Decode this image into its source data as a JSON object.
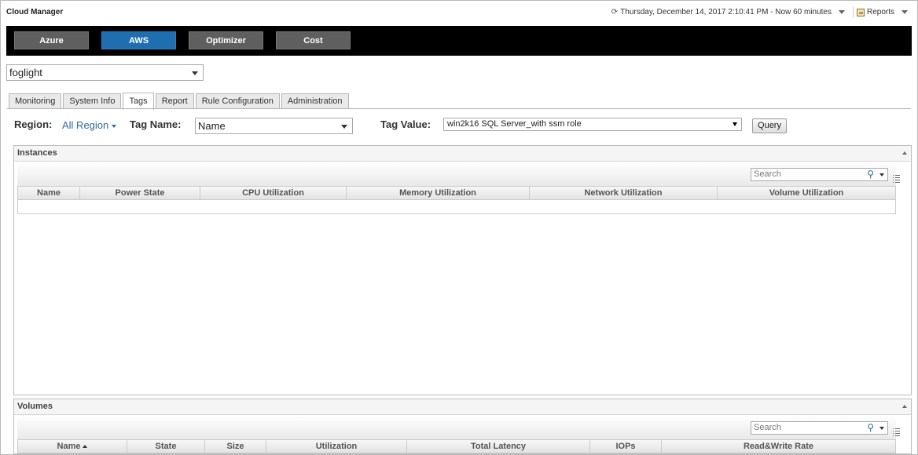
{
  "app": {
    "title": "Cloud Manager"
  },
  "time_range": {
    "label": "Thursday, December 14, 2017 2:10:41 PM - Now 60 minutes"
  },
  "reports": {
    "label": "Reports"
  },
  "nav": {
    "azure": "Azure",
    "aws": "AWS",
    "optimizer": "Optimizer",
    "cost": "Cost",
    "active": "AWS"
  },
  "server_select": {
    "value": "foglight"
  },
  "tabs": [
    "Monitoring",
    "System Info",
    "Tags",
    "Report",
    "Rule Configuration",
    "Administration"
  ],
  "active_tab": "Tags",
  "filters": {
    "region_label": "Region:",
    "region_value": "All Region",
    "tag_name_label": "Tag Name:",
    "tag_name_value": "Name",
    "tag_value_label": "Tag Value:",
    "tag_value_value": "win2k16 SQL Server_with ssm role",
    "query_label": "Query"
  },
  "instances": {
    "title": "Instances",
    "search_placeholder": "Search",
    "columns": [
      "Name",
      "Power State",
      "CPU Utilization",
      "Memory Utilization",
      "Network Utilization",
      "Volume Utilization"
    ]
  },
  "volumes": {
    "title": "Volumes",
    "search_placeholder": "Search",
    "columns": [
      "Name",
      "State",
      "Size",
      "Utilization",
      "Total Latency",
      "IOPs",
      "Read&Write Rate"
    ]
  },
  "colors": {
    "accent": "#1f6fb0",
    "nav_bg": "#000000",
    "nav_btn": "#5f5f5f"
  }
}
